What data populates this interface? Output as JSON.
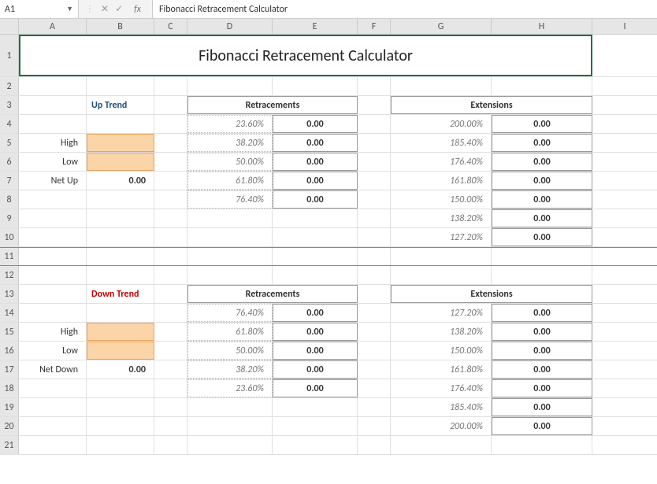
{
  "formula_bar": {
    "name_box": "A1",
    "fx_label": "fx",
    "formula": "Fibonacci Retracement Calculator"
  },
  "columns": [
    "A",
    "B",
    "C",
    "D",
    "E",
    "F",
    "G",
    "H",
    "I"
  ],
  "rows": [
    "1",
    "2",
    "3",
    "4",
    "5",
    "6",
    "7",
    "8",
    "9",
    "10",
    "11",
    "12",
    "13",
    "14",
    "15",
    "16",
    "17",
    "18",
    "19",
    "20",
    "21"
  ],
  "title": "Fibonacci Retracement Calculator",
  "up": {
    "heading": "Up Trend",
    "high_label": "High",
    "low_label": "Low",
    "net_label": "Net Up",
    "net_value": "0.00",
    "ret_header": "Retracements",
    "ext_header": "Extensions",
    "retracements": [
      {
        "pct": "23.60%",
        "val": "0.00"
      },
      {
        "pct": "38.20%",
        "val": "0.00"
      },
      {
        "pct": "50.00%",
        "val": "0.00"
      },
      {
        "pct": "61.80%",
        "val": "0.00"
      },
      {
        "pct": "76.40%",
        "val": "0.00"
      }
    ],
    "extensions": [
      {
        "pct": "200.00%",
        "val": "0.00"
      },
      {
        "pct": "185.40%",
        "val": "0.00"
      },
      {
        "pct": "176.40%",
        "val": "0.00"
      },
      {
        "pct": "161.80%",
        "val": "0.00"
      },
      {
        "pct": "150.00%",
        "val": "0.00"
      },
      {
        "pct": "138.20%",
        "val": "0.00"
      },
      {
        "pct": "127.20%",
        "val": "0.00"
      }
    ]
  },
  "down": {
    "heading": "Down Trend",
    "high_label": "High",
    "low_label": "Low",
    "net_label": "Net Down",
    "net_value": "0.00",
    "ret_header": "Retracements",
    "ext_header": "Extensions",
    "retracements": [
      {
        "pct": "76.40%",
        "val": "0.00"
      },
      {
        "pct": "61.80%",
        "val": "0.00"
      },
      {
        "pct": "50.00%",
        "val": "0.00"
      },
      {
        "pct": "38.20%",
        "val": "0.00"
      },
      {
        "pct": "23.60%",
        "val": "0.00"
      }
    ],
    "extensions": [
      {
        "pct": "127.20%",
        "val": "0.00"
      },
      {
        "pct": "138.20%",
        "val": "0.00"
      },
      {
        "pct": "150.00%",
        "val": "0.00"
      },
      {
        "pct": "161.80%",
        "val": "0.00"
      },
      {
        "pct": "176.40%",
        "val": "0.00"
      },
      {
        "pct": "185.40%",
        "val": "0.00"
      },
      {
        "pct": "200.00%",
        "val": "0.00"
      }
    ]
  }
}
